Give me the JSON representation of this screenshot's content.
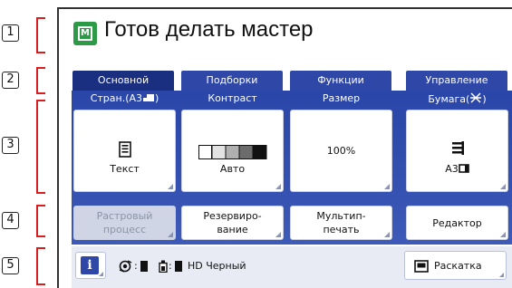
{
  "callouts": [
    "1",
    "2",
    "3",
    "4",
    "5"
  ],
  "header": {
    "title": "Готов делать мастер",
    "icon_letter": "M"
  },
  "tabs": [
    {
      "label": "Основной",
      "active": true
    },
    {
      "label": "Подборки",
      "active": false
    },
    {
      "label": "Функции",
      "active": false
    },
    {
      "label": "Управление",
      "active": false
    }
  ],
  "settings": {
    "columns": [
      {
        "label": "Стран.(A3",
        "value": "Текст",
        "icon": "document-icon"
      },
      {
        "label": "Контраст",
        "value": "Авто",
        "icon": "contrast-scale-icon"
      },
      {
        "label": "Размер",
        "value": "100%",
        "icon": ""
      },
      {
        "label": "Бумага(",
        "value": "A3",
        "icon": "paper-stack-icon"
      }
    ]
  },
  "actions": [
    {
      "label_line1": "Растровый",
      "label_line2": "процесс",
      "enabled": false
    },
    {
      "label_line1": "Резервиро-",
      "label_line2": "вание",
      "enabled": true
    },
    {
      "label_line1": "Мультип-",
      "label_line2": "печать",
      "enabled": true
    },
    {
      "label_line1": "Редактор",
      "label_line2": "",
      "enabled": true
    }
  ],
  "status": {
    "info_letter": "i",
    "drum_sep": ":",
    "ink_sep": ":",
    "ink_color": "HD Черный",
    "raskatka_label": "Раскатка"
  },
  "colors": {
    "tab_blue": "#2f47a6",
    "tab_active": "#1b2f80",
    "work_area": "#3450b0",
    "callout_red": "#d81e1e",
    "app_icon_green": "#2d9a47"
  }
}
